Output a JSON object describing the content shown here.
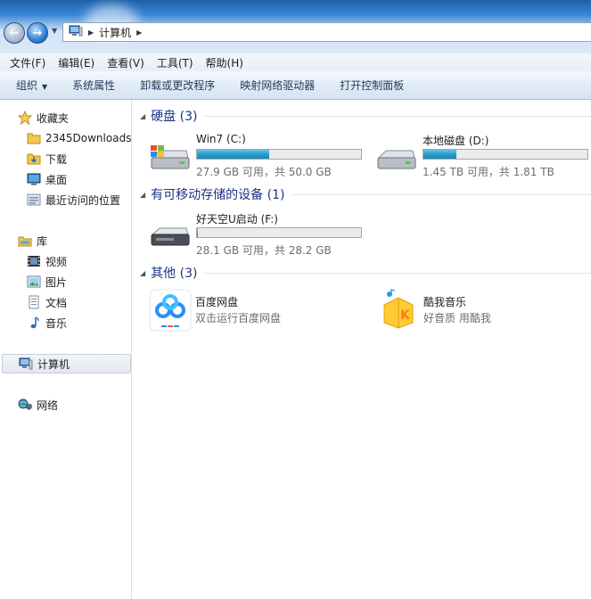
{
  "address": {
    "path": [
      "计算机"
    ]
  },
  "menu": [
    "文件(F)",
    "编辑(E)",
    "查看(V)",
    "工具(T)",
    "帮助(H)"
  ],
  "toolbar": [
    "组织",
    "系统属性",
    "卸载或更改程序",
    "映射网络驱动器",
    "打开控制面板"
  ],
  "sidebar": {
    "favorites": {
      "label": "收藏夹",
      "items": [
        "2345Downloads",
        "下载",
        "桌面",
        "最近访问的位置"
      ]
    },
    "libraries": {
      "label": "库",
      "items": [
        "视频",
        "图片",
        "文档",
        "音乐"
      ]
    },
    "computer": {
      "label": "计算机"
    },
    "network": {
      "label": "网络"
    }
  },
  "groups": {
    "hard_disks": {
      "title": "硬盘 (3)",
      "drives": [
        {
          "name": "Win7 (C:)",
          "size": "27.9 GB 可用，共 50.0 GB",
          "used_fraction": 0.44
        },
        {
          "name": "本地磁盘 (D:)",
          "size": "1.45 TB 可用，共 1.81 TB",
          "used_fraction": 0.2
        }
      ]
    },
    "removable": {
      "title": "有可移动存储的设备 (1)",
      "drives": [
        {
          "name": "好天空U启动 (F:)",
          "size": "28.1 GB 可用，共 28.2 GB",
          "used_fraction": 0.004
        }
      ]
    },
    "other": {
      "title": "其他 (3)",
      "items": [
        {
          "name": "百度网盘",
          "desc": "双击运行百度网盘"
        },
        {
          "name": "酷我音乐",
          "desc": "好音质 用酷我"
        }
      ]
    }
  }
}
